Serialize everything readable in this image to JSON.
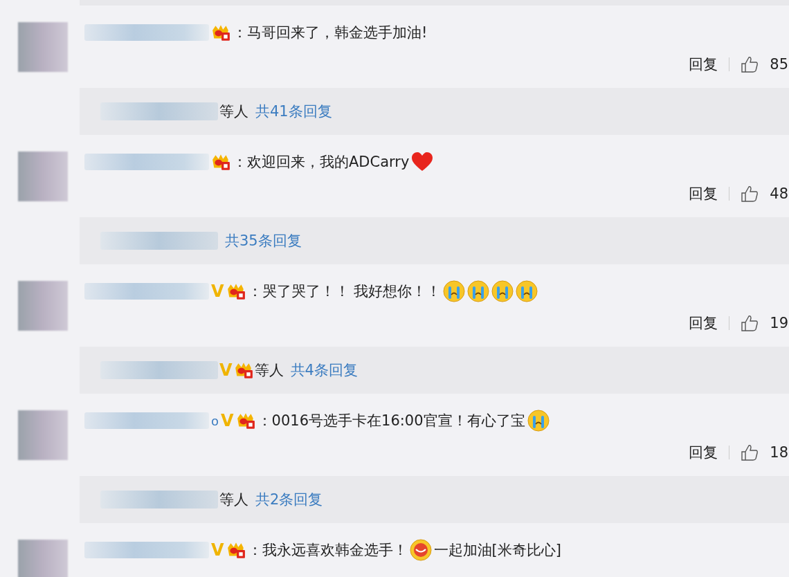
{
  "comments": [
    {
      "badges": [
        {
          "kind": "crown"
        }
      ],
      "content": [
        {
          "kind": "text",
          "text": "：马哥回来了，韩金选手加油!"
        }
      ],
      "actions": {
        "reply": "回复",
        "likes": "85"
      },
      "replies": {
        "suffix": "等人",
        "link": "共41条回复"
      }
    },
    {
      "badges": [
        {
          "kind": "crown"
        }
      ],
      "content": [
        {
          "kind": "text",
          "text": "：欢迎回来，我的ADCarry"
        },
        {
          "kind": "heart"
        }
      ],
      "actions": {
        "reply": "回复",
        "likes": "48"
      },
      "replies": {
        "link": "共35条回复"
      }
    },
    {
      "badges": [
        {
          "kind": "vip",
          "text": "V"
        },
        {
          "kind": "crown"
        }
      ],
      "content": [
        {
          "kind": "text",
          "text": "：哭了哭了！！ 我好想你！！ "
        },
        {
          "kind": "cry"
        },
        {
          "kind": "cry"
        },
        {
          "kind": "cry"
        },
        {
          "kind": "cry"
        }
      ],
      "actions": {
        "reply": "回复",
        "likes": "19"
      },
      "replies": {
        "badges": [
          {
            "kind": "vip",
            "text": "V"
          },
          {
            "kind": "crown"
          }
        ],
        "suffix": "等人",
        "link": "共4条回复"
      }
    },
    {
      "name_tail": "o",
      "badges": [
        {
          "kind": "vip",
          "text": "V"
        },
        {
          "kind": "crown"
        }
      ],
      "content": [
        {
          "kind": "text",
          "text": "：0016号选手卡在16:00官宣！有心了宝"
        },
        {
          "kind": "cry"
        }
      ],
      "actions": {
        "reply": "回复",
        "likes": "18"
      },
      "replies": {
        "suffix": "等人",
        "link": "共2条回复"
      }
    },
    {
      "badges": [
        {
          "kind": "vip",
          "text": "V"
        },
        {
          "kind": "crown"
        }
      ],
      "content": [
        {
          "kind": "text",
          "text": "：我永远喜欢韩金选手！"
        },
        {
          "kind": "blush"
        },
        {
          "kind": "text",
          "text": "一起加油[米奇比心]"
        }
      ]
    }
  ]
}
